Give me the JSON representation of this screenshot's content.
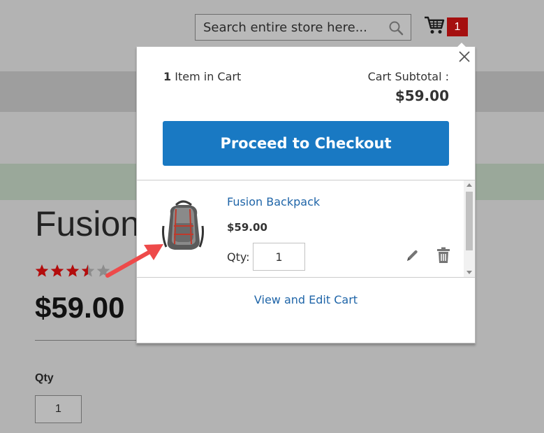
{
  "header": {
    "search_placeholder": "Search entire store here...",
    "cart_count": "1"
  },
  "product": {
    "title": "Fusion Backpack",
    "rating_full": 3,
    "rating_half": 1,
    "rating_empty": 1,
    "price": "$59.00",
    "qty_label": "Qty",
    "qty_value": "1"
  },
  "minicart": {
    "items_count": "1",
    "items_label": "Item in Cart",
    "subtotal_label": "Cart Subtotal :",
    "subtotal_value": "$59.00",
    "checkout_label": "Proceed to Checkout",
    "item": {
      "name": "Fusion Backpack",
      "price": "$59.00",
      "qty_label": "Qty:",
      "qty_value": "1"
    },
    "view_cart_label": "View and Edit Cart"
  },
  "colors": {
    "primary_button": "#1979c3",
    "link": "#1f65a8",
    "cart_badge": "#a50f0f",
    "star": "#b30c0c",
    "annotation_arrow": "#ee4a4a"
  }
}
